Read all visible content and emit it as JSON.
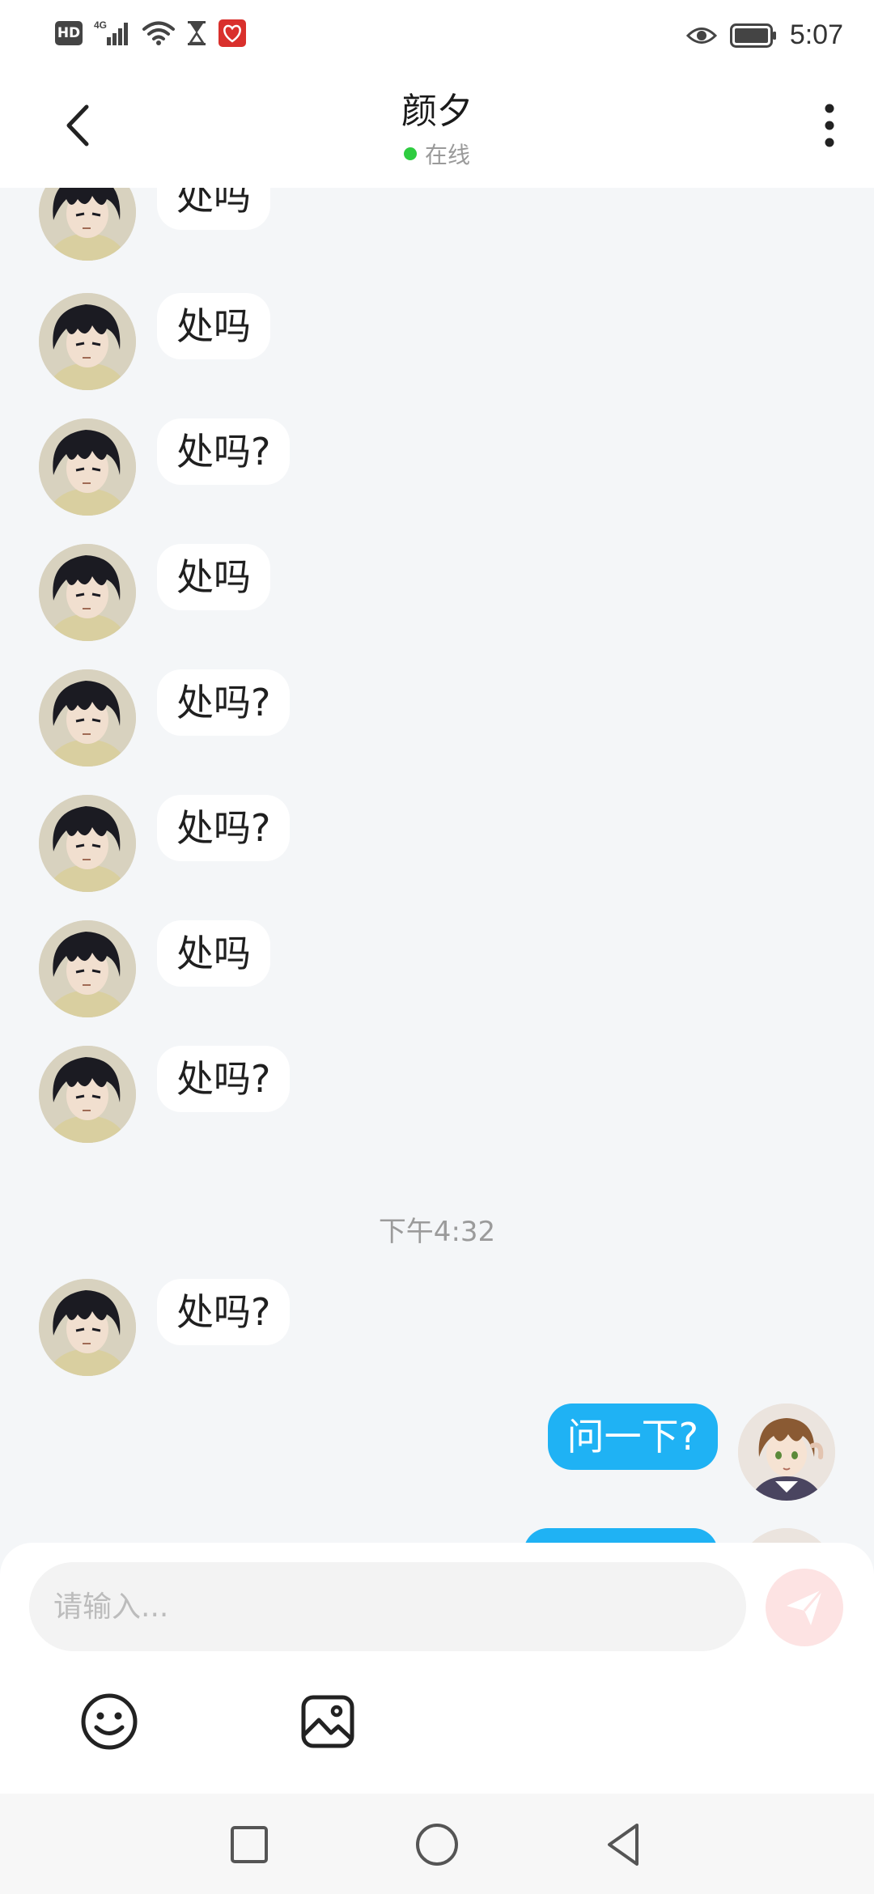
{
  "status_bar": {
    "network_badge": "HD",
    "network_type": "4G",
    "time": "5:07",
    "icons": [
      "hd-icon",
      "signal-icon",
      "wifi-icon",
      "hourglass-icon",
      "app-notification-icon",
      "eye-icon",
      "battery-icon"
    ]
  },
  "header": {
    "back_icon": "chevron-left-icon",
    "title": "颜夕",
    "status": "在线",
    "status_color": "#2ecc40",
    "more_icon": "vertical-dots-icon"
  },
  "messages_top": [
    {
      "direction": "in",
      "text": "处吗"
    },
    {
      "direction": "in",
      "text": "处吗"
    },
    {
      "direction": "in",
      "text": "处吗?"
    },
    {
      "direction": "in",
      "text": "处吗"
    },
    {
      "direction": "in",
      "text": "处吗?"
    },
    {
      "direction": "in",
      "text": "处吗?"
    },
    {
      "direction": "in",
      "text": "处吗"
    },
    {
      "direction": "in",
      "text": "处吗?"
    }
  ],
  "timestamp": "下午4:32",
  "messages_bottom": [
    {
      "direction": "in",
      "text": "处吗?"
    },
    {
      "direction": "out",
      "text": "问一下?"
    },
    {
      "direction": "out",
      "text": ""
    }
  ],
  "input": {
    "placeholder": "请输入...",
    "value": "",
    "send_icon": "paper-plane-icon",
    "send_color": "#fde3e3"
  },
  "toolbar": {
    "emoji_icon": "smiley-icon",
    "image_icon": "image-icon"
  },
  "navbar": {
    "icons": [
      "recent-apps-icon",
      "home-icon",
      "back-icon"
    ]
  },
  "colors": {
    "background": "#f4f6f8",
    "incoming_bubble": "#ffffff",
    "outgoing_bubble": "#1fb2f4"
  }
}
